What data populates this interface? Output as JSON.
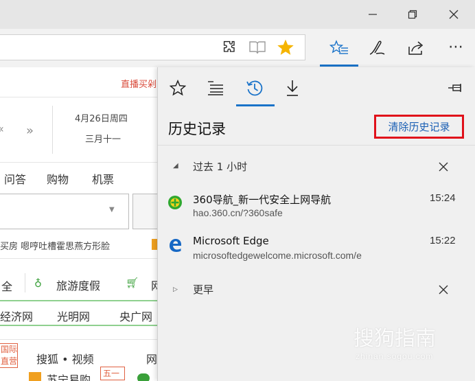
{
  "window": {
    "minimize": "—",
    "restore": "❐",
    "close": "✕"
  },
  "toolbar": {
    "extensions_icon": "puzzle-icon",
    "reading_icon": "book-icon",
    "star_icon": "star-icon",
    "hub_icon": "favorites-hub-icon",
    "notes_icon": "pen-icon",
    "share_icon": "share-icon",
    "more": "⋯"
  },
  "page": {
    "live_buy": "直播买剁",
    "date": "4月26日周四",
    "lunar": "三月十一",
    "nav": [
      "问答",
      "购物",
      "机票"
    ],
    "news_line": "买房    嗯哼吐槽霍思燕方形脸",
    "travel_prefix": "全",
    "travel": "旅游度假",
    "cart_suffix": "网",
    "links": [
      "经济网",
      "光明网",
      "央广网"
    ],
    "intl": "国际",
    "direct": "直营",
    "sohu": "搜狐 • 视频",
    "web": "网",
    "suning": "苏宁易购",
    "five": "五一"
  },
  "hub": {
    "title": "历史记录",
    "clear_label": "清除历史记录",
    "pin_icon": "pin-icon",
    "groups": [
      {
        "label": "过去 1 小时",
        "items": [
          {
            "title": "360导航_新一代安全上网导航",
            "url": "hao.360.cn/?360safe",
            "time": "15:24"
          },
          {
            "title": "Microsoft Edge",
            "url": "microsoftedgewelcome.microsoft.com/e",
            "time": "15:22"
          }
        ]
      },
      {
        "label": "更早",
        "items": []
      }
    ]
  },
  "watermark": {
    "brand": "搜狗指南",
    "domain": "zhinan.sogou.com"
  }
}
